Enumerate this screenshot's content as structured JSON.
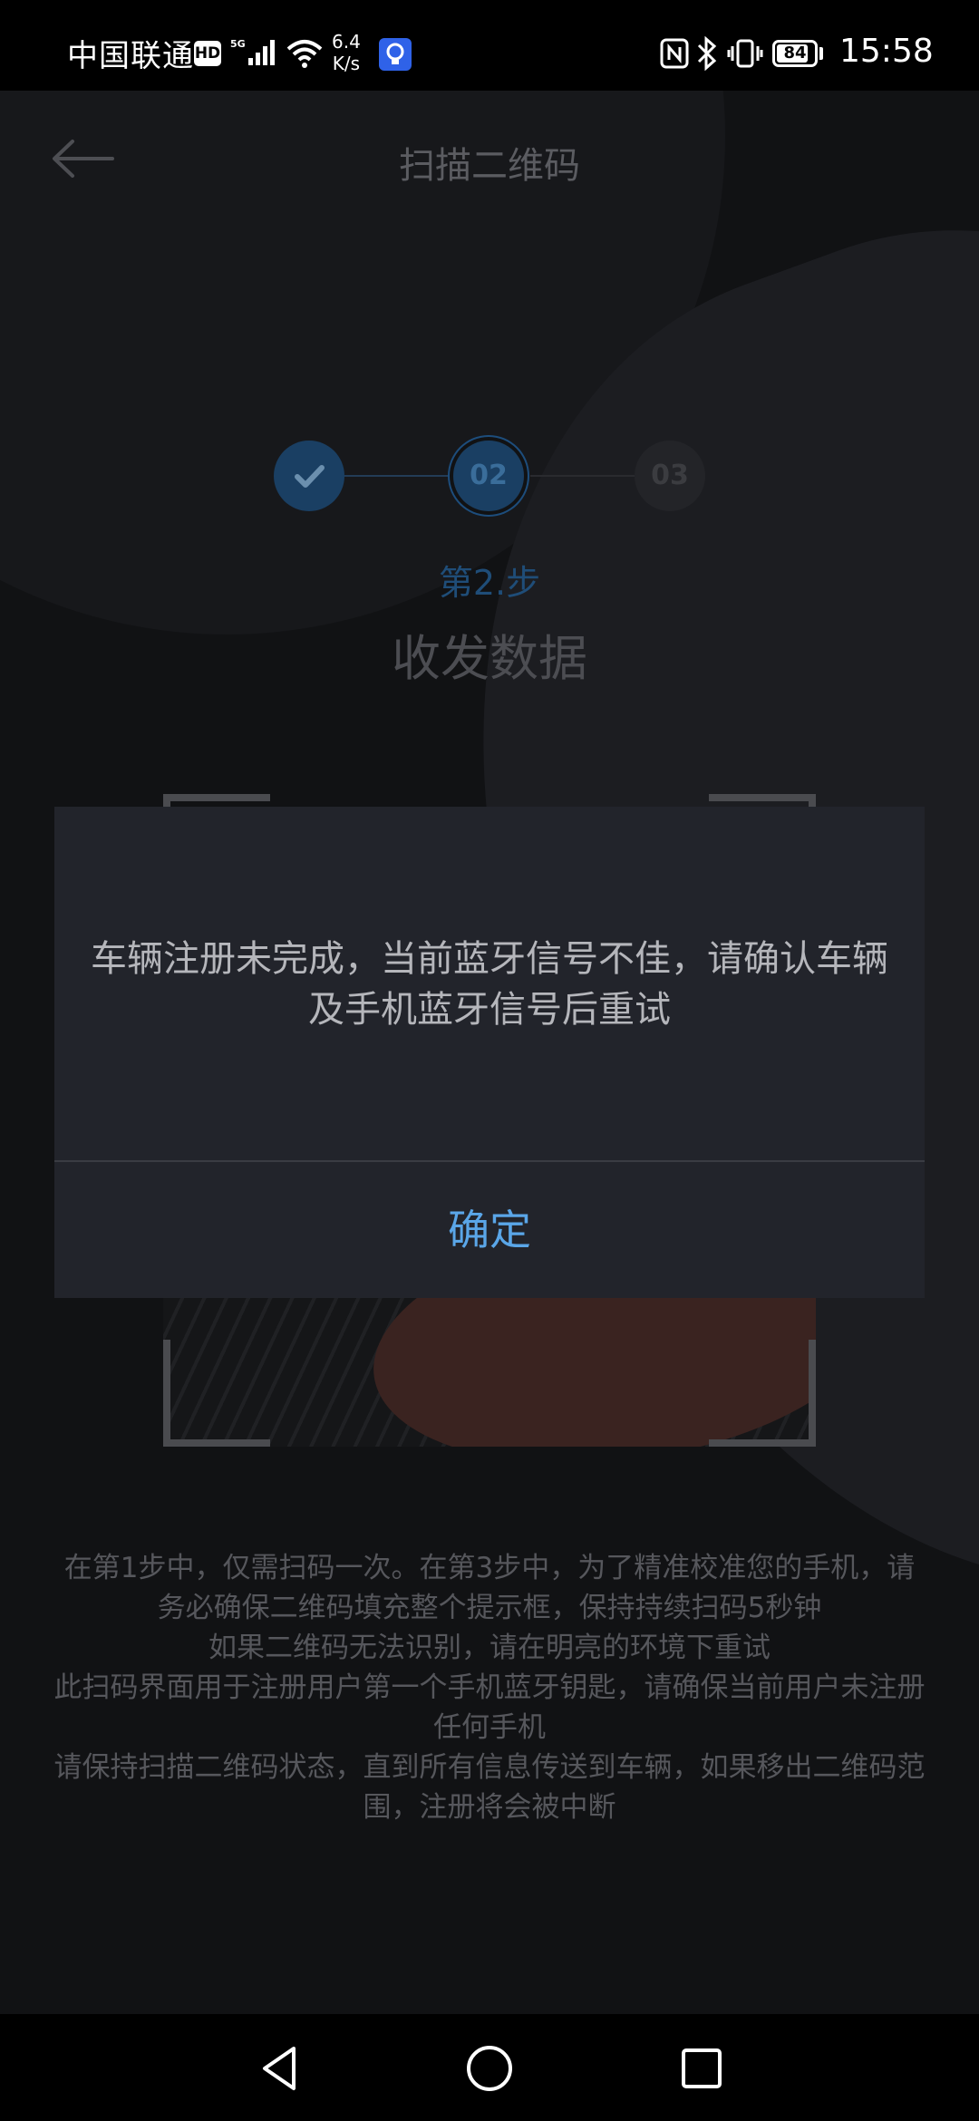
{
  "status_bar": {
    "carrier": "中国联通",
    "hd_badge": "HD",
    "net_speed_value": "6.4",
    "net_speed_unit": "K/s",
    "battery_level": "84",
    "battery_fraction": 0.84,
    "time": "15:58"
  },
  "header": {
    "title": "扫描二维码"
  },
  "stepper": {
    "steps": [
      {
        "label": "",
        "state": "completed"
      },
      {
        "label": "02",
        "state": "active"
      },
      {
        "label": "03",
        "state": "pending"
      }
    ],
    "current_label": "第2.步",
    "current_title": "收发数据"
  },
  "instructions": [
    "在第1步中，仅需扫码一次。在第3步中，为了精准校准您的手机，请务必确保二维码填充整个提示框，保持持续扫码5秒钟",
    "如果二维码无法识别，请在明亮的环境下重试",
    "此扫码界面用于注册用户第一个手机蓝牙钥匙，请确保当前用户未注册任何手机",
    "请保持扫描二维码状态，直到所有信息传送到车辆，如果移出二维码范围，注册将会被中断"
  ],
  "dialog": {
    "message": "车辆注册未完成，当前蓝牙信号不佳，请确认车辆及手机蓝牙信号后重试",
    "confirm_label": "确定"
  },
  "colors": {
    "accent": "#5aa6e8",
    "dialog_bg": "#22242b",
    "step_active": "#1a3f63"
  },
  "icons": {
    "back": "arrow-left-icon",
    "step_done": "check-icon",
    "nav_back": "triangle-back-icon",
    "nav_home": "circle-home-icon",
    "nav_recent": "square-recent-icon"
  }
}
